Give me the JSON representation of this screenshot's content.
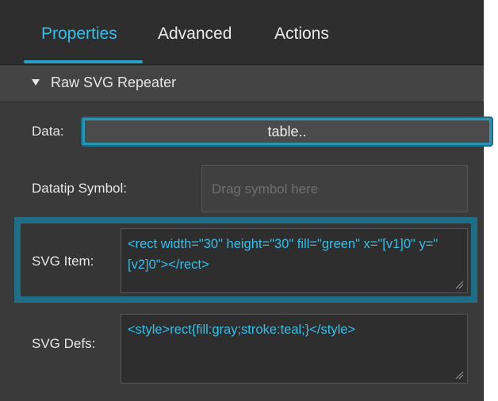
{
  "tabs": [
    {
      "label": "Properties",
      "active": true
    },
    {
      "label": "Advanced",
      "active": false
    },
    {
      "label": "Actions",
      "active": false
    }
  ],
  "section": {
    "title": "Raw SVG Repeater",
    "icon": "triangle-down-icon",
    "expanded": true
  },
  "fields": {
    "data": {
      "label": "Data:",
      "value": "table.."
    },
    "datatip_symbol": {
      "label": "Datatip Symbol:",
      "placeholder": "Drag symbol here"
    },
    "svg_item": {
      "label": "SVG Item:",
      "value": "<rect width=\"30\" height=\"30\" fill=\"green\" x=\"[v1]0\" y=\"[v2]0\"></rect>"
    },
    "svg_defs": {
      "label": "SVG Defs:",
      "value": "<style>rect{fill:gray;stroke:teal;}</style>"
    }
  },
  "colors": {
    "accent": "#35bfe9",
    "focus": "#1e6f85",
    "panel": "#3a3a3a"
  }
}
